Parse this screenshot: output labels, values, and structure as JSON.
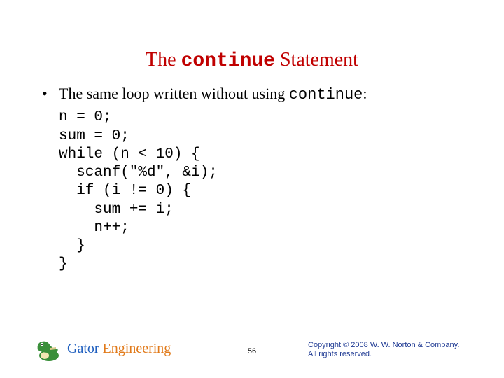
{
  "title": {
    "pre": "The ",
    "mono": "continue",
    "post": " Statement"
  },
  "bullet": {
    "pre": "The same loop written without using ",
    "mono": "continue",
    "post": ":"
  },
  "code": "n = 0;\nsum = 0;\nwhile (n < 10) {\n  scanf(\"%d\", &i);\n  if (i != 0) {\n    sum += i;\n    n++;\n  }\n}",
  "footer": {
    "brand_a": "Gator ",
    "brand_b": "Engineering",
    "page": "56",
    "copyright_l1": "Copyright © 2008 W. W. Norton & Company.",
    "copyright_l2": "All rights reserved."
  }
}
